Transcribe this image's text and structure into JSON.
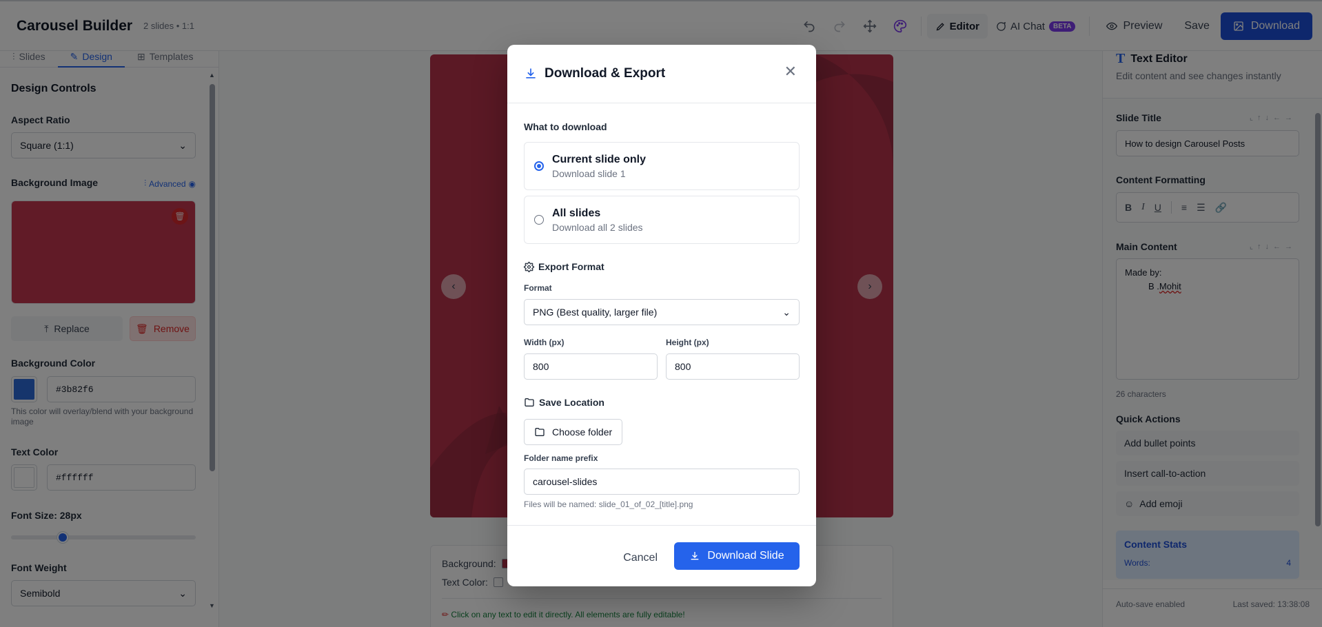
{
  "header": {
    "title": "Carousel Builder",
    "meta": "2 slides • 1:1",
    "editor_label": "Editor",
    "ai_chat_label": "AI Chat",
    "beta_badge": "BETA",
    "preview_label": "Preview",
    "save_label": "Save",
    "download_label": "Download"
  },
  "left_panel": {
    "tabs": [
      {
        "label": "Slides"
      },
      {
        "label": "Design"
      },
      {
        "label": "Templates"
      }
    ],
    "heading": "Design Controls",
    "aspect_ratio_label": "Aspect Ratio",
    "aspect_ratio_value": "Square (1:1)",
    "bg_image_label": "Background Image",
    "advanced_label": "Advanced",
    "replace_label": "Replace",
    "remove_label": "Remove",
    "bg_color_label": "Background Color",
    "bg_color_value": "#3b82f6",
    "bg_color_hint": "This color will overlay/blend with your background image",
    "text_color_label": "Text Color",
    "text_color_value": "#ffffff",
    "font_size_label": "Font Size: 28px",
    "font_size_fraction": 0.28,
    "font_weight_label": "Font Weight",
    "font_weight_value": "Semibold"
  },
  "canvas": {
    "slide_color": "#b7334a",
    "props_background_label": "Background:",
    "props_text_color_label": "Text Color:",
    "props_hint": "Click on any text to edit it directly. All elements are fully editable!"
  },
  "right_panel": {
    "title": "Text Editor",
    "subtitle": "Edit content and see changes instantly",
    "slide_title_label": "Slide Title",
    "slide_title_value": "How to design Carousel Posts",
    "content_formatting_label": "Content Formatting",
    "main_content_label": "Main Content",
    "main_content_line1": "Made by:",
    "main_content_line2_prefix": "B .",
    "main_content_line2_word": "Mohit",
    "char_count": "26 characters",
    "quick_actions_label": "Quick Actions",
    "quick_actions": [
      {
        "label": "Add bullet points"
      },
      {
        "label": "Insert call-to-action"
      },
      {
        "label": "Add emoji"
      }
    ],
    "stats_title": "Content Stats",
    "stats_words_label": "Words:",
    "stats_words_value": "4",
    "autosave": "Auto-save enabled",
    "last_saved": "Last saved: 13:38:08"
  },
  "modal": {
    "title": "Download & Export",
    "what_label": "What to download",
    "options": [
      {
        "title": "Current slide only",
        "sub": "Download slide 1",
        "checked": true
      },
      {
        "title": "All slides",
        "sub": "Download all 2 slides",
        "checked": false
      }
    ],
    "export_format_label": "Export Format",
    "format_label": "Format",
    "format_value": "PNG (Best quality, larger file)",
    "width_label": "Width (px)",
    "width_value": "800",
    "height_label": "Height (px)",
    "height_value": "800",
    "save_location_label": "Save Location",
    "choose_folder_label": "Choose folder",
    "prefix_label": "Folder name prefix",
    "prefix_value": "carousel-slides",
    "filename_hint": "Files will be named: slide_01_of_02_[title].png",
    "cancel_label": "Cancel",
    "download_label": "Download Slide"
  },
  "colors": {
    "accent": "#2563eb",
    "slide_bg": "#b7334a",
    "bg_swatch": "#3b82f6",
    "text_swatch": "#ffffff"
  }
}
